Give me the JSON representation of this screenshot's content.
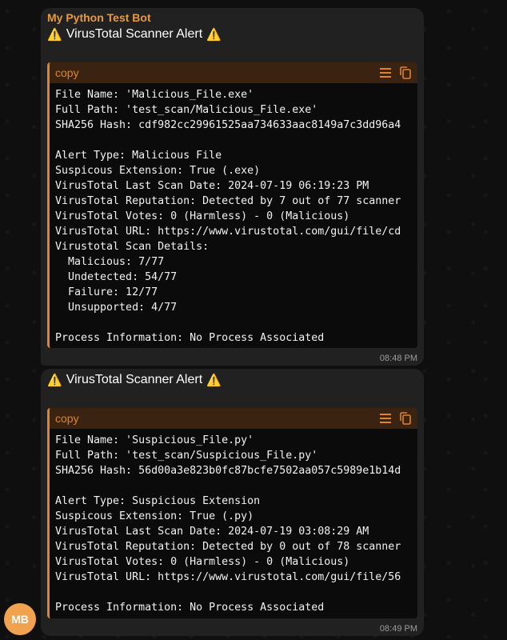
{
  "messages": [
    {
      "sender": "My Python Test Bot",
      "warn_icon": "⚠️",
      "title": "VirusTotal Scanner Alert",
      "code_label": "copy",
      "lines": [
        "File Name: 'Malicious_File.exe'",
        "Full Path: 'test_scan/Malicious_File.exe'",
        "SHA256 Hash: cdf982cc29961525aa734633aac8149a7c3dd96a4",
        "",
        "Alert Type: Malicious File",
        "Suspicous Extension: True (.exe)",
        "VirusTotal Last Scan Date: 2024-07-19 06:19:23 PM",
        "VirusTotal Reputation: Detected by 7 out of 77 scanner",
        "VirusTotal Votes: 0 (Harmless) - 0 (Malicious)",
        "VirusTotal URL: https://www.virustotal.com/gui/file/cd",
        "Virustotal Scan Details:",
        "  Malicious: 7/77",
        "  Undetected: 54/77",
        "  Failure: 12/77",
        "  Unsupported: 4/77",
        "",
        "Process Information: No Process Associated"
      ],
      "time": "08:48 PM"
    },
    {
      "warn_icon": "⚠️",
      "title": "VirusTotal Scanner Alert",
      "code_label": "copy",
      "lines": [
        "File Name: 'Suspicious_File.py'",
        "Full Path: 'test_scan/Suspicious_File.py'",
        "SHA256 Hash: 56d00a3e823b0fc87bcfe7502aa057c5989e1b14d",
        "",
        "Alert Type: Suspicious Extension",
        "Suspicous Extension: True (.py)",
        "VirusTotal Last Scan Date: 2024-07-19 03:08:29 AM",
        "VirusTotal Reputation: Detected by 0 out of 78 scanner",
        "VirusTotal Votes: 0 (Harmless) - 0 (Malicious)",
        "VirusTotal URL: https://www.virustotal.com/gui/file/56",
        "",
        "Process Information: No Process Associated"
      ],
      "time": "08:49 PM"
    }
  ],
  "avatar": {
    "initials": "MB",
    "color": "#f0a24e"
  },
  "colors": {
    "accent": "#e0832a",
    "sender": "#e39a45",
    "bubble": "#212121"
  }
}
